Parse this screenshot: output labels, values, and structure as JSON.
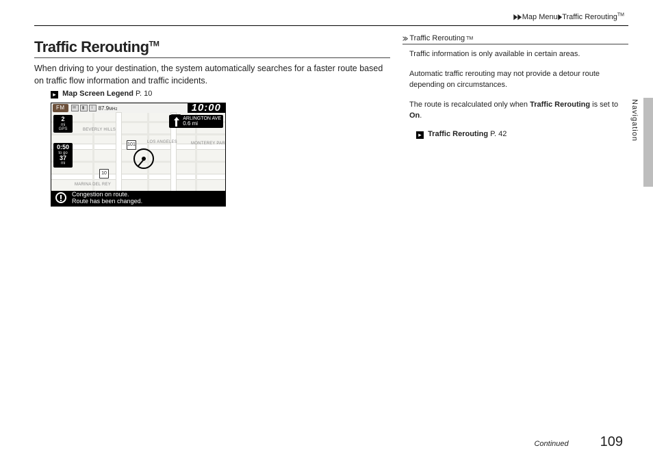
{
  "breadcrumb": {
    "a": "Map Menu",
    "b": "Traffic Rerouting",
    "tm": "TM"
  },
  "title": {
    "text": "Traffic Rerouting",
    "tm": "TM"
  },
  "intro": "When driving to your destination, the system automatically searches for a faster route based on traffic flow information and traffic incidents.",
  "xref1": {
    "label": "Map Screen Legend",
    "page": "P. 10"
  },
  "screenshot": {
    "fm": "FM",
    "freq_num": "87.9",
    "freq_unit": "MHz",
    "clock": "10:00",
    "turn_street": "ARLINGTON AVE",
    "turn_dist": "0.6",
    "turn_unit": "mi",
    "scale_val": "2",
    "scale_unit": "mi",
    "gps": "GPS",
    "eta_time": "0:50",
    "eta_label": "to go",
    "dist_val": "37",
    "dist_unit": "mi",
    "label_bh": "BEVERLY HILLS",
    "label_la": "LOS ANGELES",
    "label_mp": "MONTEREY PAR",
    "label_md": "MARINA DEL REY",
    "shield_5": "5",
    "shield_101": "101",
    "shield_10": "10",
    "alert_line1": "Congestion on route.",
    "alert_line2": "Route has been changed."
  },
  "side": {
    "title": "Traffic Rerouting",
    "tm": "TM",
    "p1": "Traffic information is only available in certain areas.",
    "p2": "Automatic traffic rerouting may not provide a detour route depending on circumstances.",
    "p3a": "The route is recalculated only when ",
    "p3b": "Traffic Rerouting",
    "p3c": " is set to ",
    "p3d": "On",
    "p3e": ".",
    "xref_label": "Traffic Rerouting",
    "xref_page": "P. 42"
  },
  "tab": "Navigation",
  "footer": {
    "continued": "Continued",
    "page": "109"
  }
}
